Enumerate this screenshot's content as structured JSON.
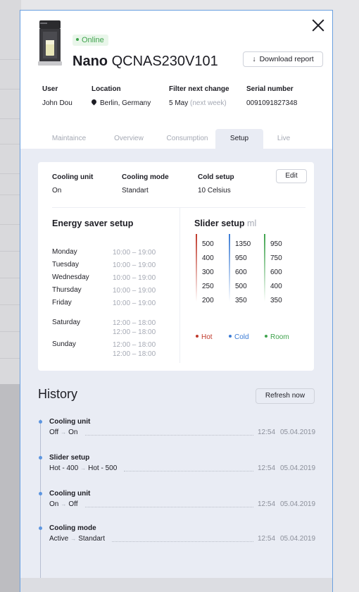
{
  "device": {
    "status": "Online",
    "name_bold": "Nano",
    "name_model": "QCNAS230V101",
    "download_label": "Download report"
  },
  "info": {
    "user_label": "User",
    "user_value": "John Dou",
    "location_label": "Location",
    "location_value": "Berlin, Germany",
    "filter_label": "Filter next change",
    "filter_value": "5 May",
    "filter_note": "(next week)",
    "serial_label": "Serial number",
    "serial_value": "0091091827348"
  },
  "tabs": [
    "Maintaince",
    "Overview",
    "Consumption",
    "Setup",
    "Live"
  ],
  "active_tab": "Setup",
  "cooling": {
    "unit_label": "Cooling unit",
    "unit_value": "On",
    "mode_label": "Cooling mode",
    "mode_value": "Standart",
    "cold_label": "Cold setup",
    "cold_value": "10 Celsius",
    "edit_label": "Edit"
  },
  "energy": {
    "title": "Energy saver setup",
    "schedule": [
      {
        "day": "Monday",
        "times": [
          "10:00 – 19:00"
        ]
      },
      {
        "day": "Tuesday",
        "times": [
          "10:00 – 19:00"
        ]
      },
      {
        "day": "Wednesday",
        "times": [
          "10:00 – 19:00"
        ]
      },
      {
        "day": "Thursday",
        "times": [
          "10:00 – 19:00"
        ]
      },
      {
        "day": "Friday",
        "times": [
          "10:00 – 19:00"
        ]
      },
      {
        "day": "Saturday",
        "times": [
          "12:00 – 18:00",
          "12:00 – 18:00"
        ]
      },
      {
        "day": "Sunday",
        "times": [
          "12:00 – 18:00",
          "12:00 – 18:00"
        ]
      }
    ]
  },
  "slider": {
    "title": "Slider setup",
    "unit": "ml",
    "columns": [
      {
        "name": "Hot",
        "color": "#c0392b",
        "values": [
          "500",
          "400",
          "300",
          "250",
          "200"
        ]
      },
      {
        "name": "Cold",
        "color": "#3a7bd5",
        "values": [
          "1350",
          "950",
          "600",
          "500",
          "350"
        ]
      },
      {
        "name": "Room",
        "color": "#3fa34d",
        "values": [
          "950",
          "750",
          "600",
          "400",
          "350"
        ]
      }
    ]
  },
  "history": {
    "title": "History",
    "refresh_label": "Refresh now",
    "items": [
      {
        "title": "Cooling unit",
        "from": "Off",
        "to": "On",
        "time": "12:54",
        "date": "05.04.2019"
      },
      {
        "title": "Slider setup",
        "from": "Hot - 400",
        "to": "Hot - 500",
        "time": "12:54",
        "date": "05.04.2019"
      },
      {
        "title": "Cooling unit",
        "from": "On",
        "to": "Off",
        "time": "12:54",
        "date": "05.04.2019"
      },
      {
        "title": "Cooling mode",
        "from": "Active",
        "to": "Standart",
        "time": "12:54",
        "date": "05.04.2019"
      }
    ]
  }
}
